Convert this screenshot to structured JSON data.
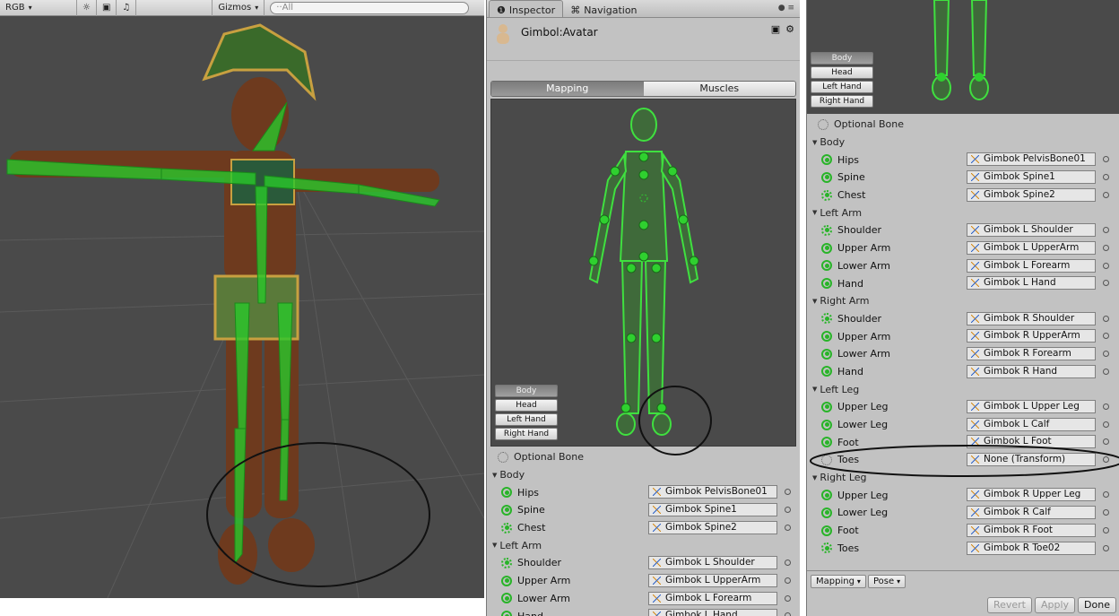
{
  "scene": {
    "toolbar": {
      "mode": "RGB",
      "gizmos": "Gizmos",
      "search_placeholder": "··All"
    }
  },
  "inspector": {
    "tabs": {
      "inspector": "Inspector",
      "navigation": "Navigation"
    },
    "title": "Gimbol:Avatar",
    "segments": [
      "Mapping",
      "Muscles"
    ],
    "view_tabs": [
      "Body",
      "Head",
      "Left Hand",
      "Right Hand"
    ],
    "optional_bone": "Optional Bone",
    "rows": [
      {
        "kind": "section",
        "label": "Body"
      },
      {
        "kind": "bone",
        "label": "Hips",
        "value": "Gimbok PelvisBone01"
      },
      {
        "kind": "bone",
        "label": "Spine",
        "value": "Gimbok Spine1"
      },
      {
        "kind": "bone",
        "label": "Chest",
        "value": "Gimbok Spine2",
        "optional": true
      },
      {
        "kind": "section",
        "label": "Left Arm"
      },
      {
        "kind": "bone",
        "label": "Shoulder",
        "value": "Gimbok L Shoulder",
        "optional": true
      },
      {
        "kind": "bone",
        "label": "Upper Arm",
        "value": "Gimbok L UpperArm"
      },
      {
        "kind": "bone",
        "label": "Lower Arm",
        "value": "Gimbok L Forearm"
      },
      {
        "kind": "bone",
        "label": "Hand",
        "value": "Gimbok L Hand"
      }
    ]
  },
  "panel2": {
    "view_tabs": [
      "Body",
      "Head",
      "Left Hand",
      "Right Hand"
    ],
    "optional_bone": "Optional Bone",
    "rows": [
      {
        "kind": "section",
        "label": "Body"
      },
      {
        "kind": "bone",
        "label": "Hips",
        "value": "Gimbok PelvisBone01"
      },
      {
        "kind": "bone",
        "label": "Spine",
        "value": "Gimbok Spine1"
      },
      {
        "kind": "bone",
        "label": "Chest",
        "value": "Gimbok Spine2",
        "optional": true
      },
      {
        "kind": "section",
        "label": "Left Arm"
      },
      {
        "kind": "bone",
        "label": "Shoulder",
        "value": "Gimbok L Shoulder",
        "optional": true
      },
      {
        "kind": "bone",
        "label": "Upper Arm",
        "value": "Gimbok L UpperArm"
      },
      {
        "kind": "bone",
        "label": "Lower Arm",
        "value": "Gimbok L Forearm"
      },
      {
        "kind": "bone",
        "label": "Hand",
        "value": "Gimbok L Hand"
      },
      {
        "kind": "section",
        "label": "Right Arm"
      },
      {
        "kind": "bone",
        "label": "Shoulder",
        "value": "Gimbok R Shoulder",
        "optional": true
      },
      {
        "kind": "bone",
        "label": "Upper Arm",
        "value": "Gimbok R UpperArm"
      },
      {
        "kind": "bone",
        "label": "Lower Arm",
        "value": "Gimbok R Forearm"
      },
      {
        "kind": "bone",
        "label": "Hand",
        "value": "Gimbok R Hand"
      },
      {
        "kind": "section",
        "label": "Left Leg"
      },
      {
        "kind": "bone",
        "label": "Upper Leg",
        "value": "Gimbok L Upper Leg"
      },
      {
        "kind": "bone",
        "label": "Lower Leg",
        "value": "Gimbok L Calf"
      },
      {
        "kind": "bone",
        "label": "Foot",
        "value": "Gimbok L Foot"
      },
      {
        "kind": "bone",
        "label": "Toes",
        "value": "None (Transform)",
        "empty": true
      },
      {
        "kind": "section",
        "label": "Right Leg"
      },
      {
        "kind": "bone",
        "label": "Upper Leg",
        "value": "Gimbok R Upper Leg"
      },
      {
        "kind": "bone",
        "label": "Lower Leg",
        "value": "Gimbok R Calf"
      },
      {
        "kind": "bone",
        "label": "Foot",
        "value": "Gimbok R Foot"
      },
      {
        "kind": "bone",
        "label": "Toes",
        "value": "Gimbok R Toe02",
        "optional": true
      }
    ],
    "bottom_bar": {
      "mapping": "Mapping",
      "pose": "Pose"
    },
    "actions": {
      "revert": "Revert",
      "apply": "Apply",
      "done": "Done"
    }
  },
  "colors": {
    "bone_green": "#28b428",
    "viewport_bg": "#4a4a4a",
    "panel_bg": "#c2c2c2"
  }
}
